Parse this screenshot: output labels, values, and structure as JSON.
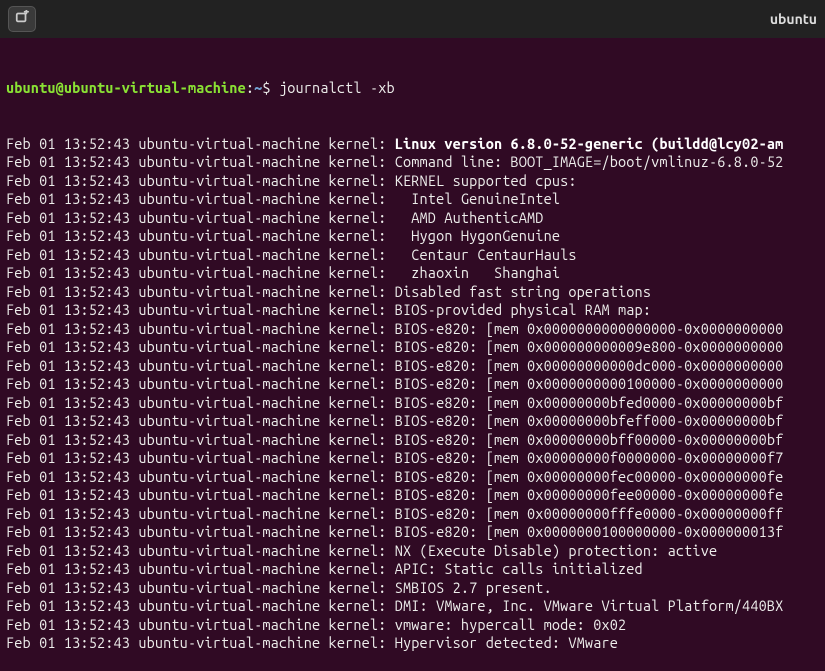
{
  "titlebar": {
    "title": "ubuntu"
  },
  "prompt": {
    "user": "ubuntu",
    "at": "@",
    "host": "ubuntu-virtual-machine",
    "colon": ":",
    "path": "~",
    "sign": "$ ",
    "command": "journalctl -xb"
  },
  "prefix": {
    "ts": "Feb 01 13:52:43 ",
    "host": "ubuntu-virtual-machine ",
    "src": "kernel: "
  },
  "lines": [
    {
      "bold": true,
      "msg": "Linux version 6.8.0-52-generic (buildd@lcy02-am"
    },
    {
      "bold": false,
      "msg": "Command line: BOOT_IMAGE=/boot/vmlinuz-6.8.0-52"
    },
    {
      "bold": false,
      "msg": "KERNEL supported cpus:"
    },
    {
      "bold": false,
      "msg": "  Intel GenuineIntel"
    },
    {
      "bold": false,
      "msg": "  AMD AuthenticAMD"
    },
    {
      "bold": false,
      "msg": "  Hygon HygonGenuine"
    },
    {
      "bold": false,
      "msg": "  Centaur CentaurHauls"
    },
    {
      "bold": false,
      "msg": "  zhaoxin   Shanghai"
    },
    {
      "bold": false,
      "msg": "Disabled fast string operations"
    },
    {
      "bold": false,
      "msg": "BIOS-provided physical RAM map:"
    },
    {
      "bold": false,
      "msg": "BIOS-e820: [mem 0x0000000000000000-0x0000000000"
    },
    {
      "bold": false,
      "msg": "BIOS-e820: [mem 0x000000000009e800-0x0000000000"
    },
    {
      "bold": false,
      "msg": "BIOS-e820: [mem 0x00000000000dc000-0x0000000000"
    },
    {
      "bold": false,
      "msg": "BIOS-e820: [mem 0x0000000000100000-0x0000000000"
    },
    {
      "bold": false,
      "msg": "BIOS-e820: [mem 0x00000000bfed0000-0x00000000bf"
    },
    {
      "bold": false,
      "msg": "BIOS-e820: [mem 0x00000000bfeff000-0x00000000bf"
    },
    {
      "bold": false,
      "msg": "BIOS-e820: [mem 0x00000000bff00000-0x00000000bf"
    },
    {
      "bold": false,
      "msg": "BIOS-e820: [mem 0x00000000f0000000-0x00000000f7"
    },
    {
      "bold": false,
      "msg": "BIOS-e820: [mem 0x00000000fec00000-0x00000000fe"
    },
    {
      "bold": false,
      "msg": "BIOS-e820: [mem 0x00000000fee00000-0x00000000fe"
    },
    {
      "bold": false,
      "msg": "BIOS-e820: [mem 0x00000000fffe0000-0x00000000ff"
    },
    {
      "bold": false,
      "msg": "BIOS-e820: [mem 0x0000000100000000-0x000000013f"
    },
    {
      "bold": false,
      "msg": "NX (Execute Disable) protection: active"
    },
    {
      "bold": false,
      "msg": "APIC: Static calls initialized"
    },
    {
      "bold": false,
      "msg": "SMBIOS 2.7 present."
    },
    {
      "bold": false,
      "msg": "DMI: VMware, Inc. VMware Virtual Platform/440BX"
    },
    {
      "bold": false,
      "msg": "vmware: hypercall mode: 0x02"
    },
    {
      "bold": false,
      "msg": "Hypervisor detected: VMware"
    }
  ]
}
